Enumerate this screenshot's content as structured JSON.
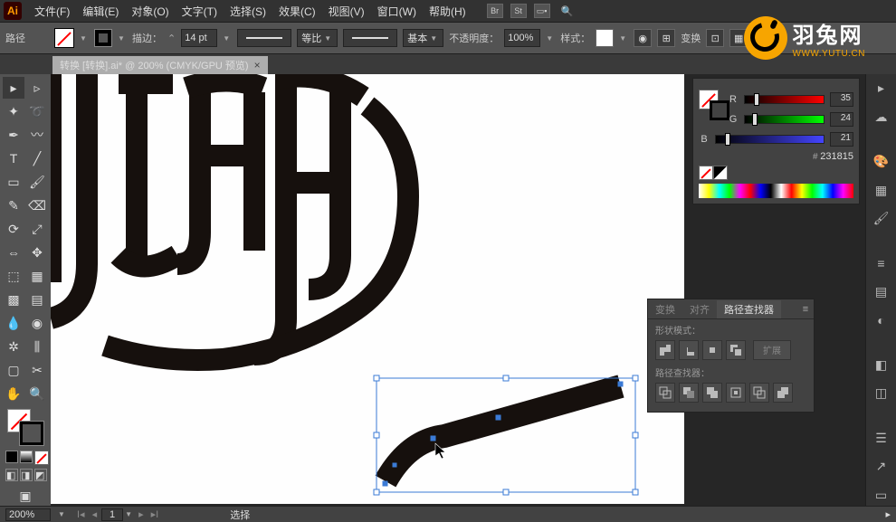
{
  "app": {
    "icon_label": "Ai"
  },
  "menus": [
    "文件(F)",
    "编辑(E)",
    "对象(O)",
    "文字(T)",
    "选择(S)",
    "效果(C)",
    "视图(V)",
    "窗口(W)",
    "帮助(H)"
  ],
  "topbar_badges": [
    "Br",
    "St"
  ],
  "control": {
    "mode_label": "路径",
    "stroke_label": "描边：",
    "stroke_weight": "14 pt",
    "profile_uniform": "等比",
    "brush_basic": "基本",
    "opacity_label": "不透明度：",
    "opacity_value": "100%",
    "style_label": "样式：",
    "transform_label": "变换"
  },
  "doctab": {
    "title": "转换 [转换].ai* @ 200% (CMYK/GPU 预览)"
  },
  "color_panel": {
    "channels": [
      {
        "letter": "R",
        "value": "35"
      },
      {
        "letter": "G",
        "value": "24"
      },
      {
        "letter": "B",
        "value": "21"
      }
    ],
    "hex": "231815"
  },
  "pathfinder": {
    "tabs": [
      "变换",
      "对齐",
      "路径查找器"
    ],
    "shape_modes_label": "形状模式：",
    "expand_label": "扩展",
    "pathfinders_label": "路径查找器："
  },
  "statusbar": {
    "zoom": "200%",
    "page": "1",
    "tool": "选择"
  },
  "watermark": {
    "name": "羽兔网",
    "url": "WWW.YUTU.CN"
  },
  "tools_left": [
    "selection",
    "direct-select",
    "magic-wand",
    "lasso",
    "pen",
    "curvature",
    "type",
    "line",
    "rectangle",
    "paintbrush",
    "pencil",
    "eraser",
    "rotate",
    "scale",
    "width",
    "free-transform",
    "shape-builder",
    "perspective",
    "mesh",
    "gradient",
    "eyedropper",
    "blend",
    "symbol-spray",
    "graph",
    "artboard",
    "slice",
    "hand",
    "zoom"
  ],
  "icons": {
    "selection": "▸",
    "direct-select": "▹",
    "magic-wand": "✦",
    "lasso": "➰",
    "pen": "✒",
    "curvature": "〰",
    "type": "T",
    "line": "╱",
    "rectangle": "▭",
    "paintbrush": "🖌",
    "pencil": "✎",
    "eraser": "⌫",
    "rotate": "⟳",
    "scale": "⤢",
    "width": "⇔",
    "free-transform": "✥",
    "shape-builder": "⬚",
    "perspective": "▦",
    "mesh": "▩",
    "gradient": "▤",
    "eyedropper": "💧",
    "blend": "◉",
    "symbol-spray": "✲",
    "graph": "⫼",
    "artboard": "▢",
    "slice": "✂",
    "hand": "✋",
    "zoom": "🔍"
  }
}
